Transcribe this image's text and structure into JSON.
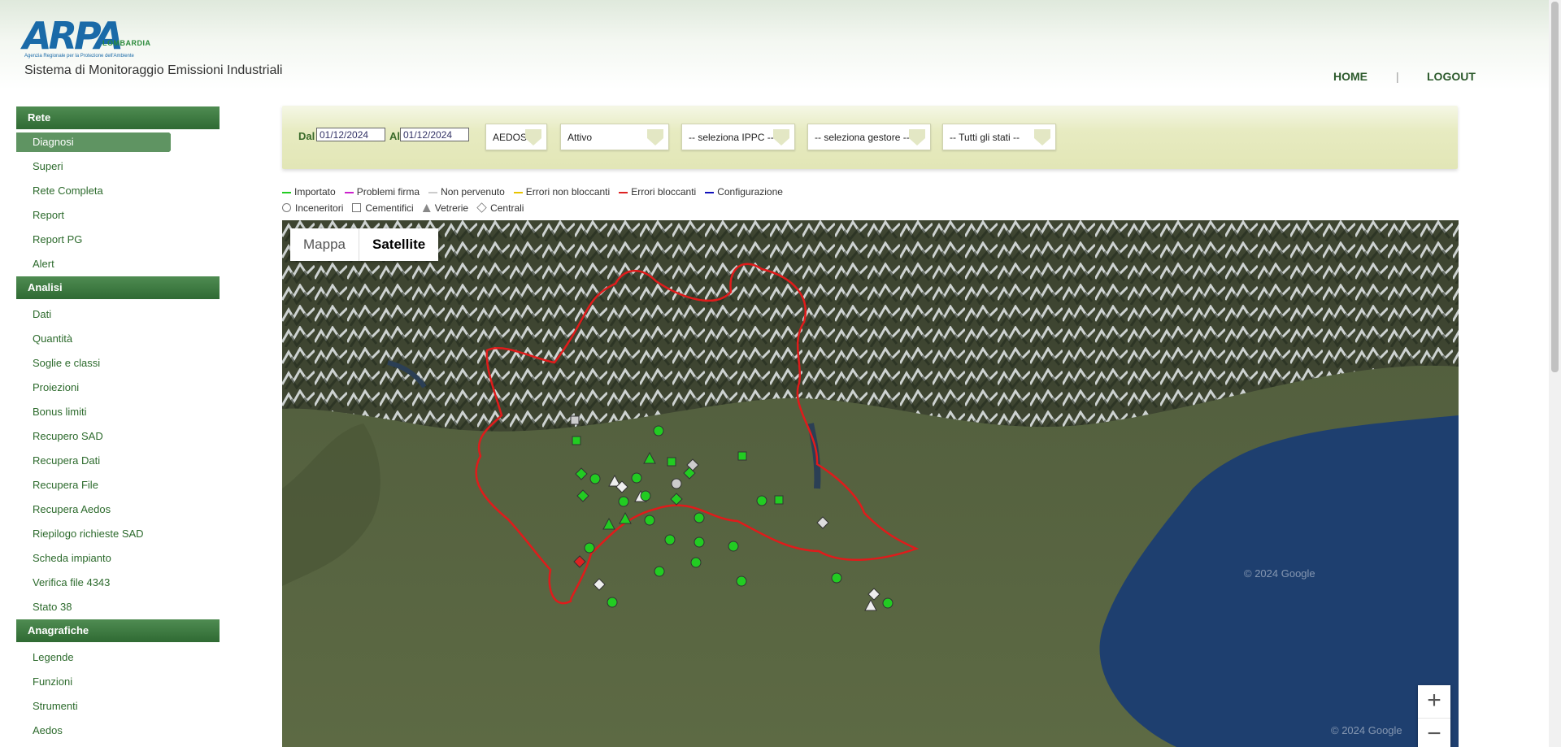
{
  "header": {
    "logo_text": "ARPA",
    "logo_region": "LOMBARDIA",
    "logo_tagline": "Agenzia Regionale per la Protezione dell'Ambiente",
    "app_title": "Sistema di Monitoraggio Emissioni Industriali",
    "nav_home": "HOME",
    "nav_separator": "|",
    "nav_logout": "LOGOUT"
  },
  "sidebar": {
    "sections": [
      {
        "title": "Rete",
        "items": [
          "Diagnosi",
          "Superi",
          "Rete Completa",
          "Report",
          "Report PG",
          "Alert"
        ],
        "active": "Diagnosi"
      },
      {
        "title": "Analisi",
        "items": [
          "Dati",
          "Quantità",
          "Soglie e classi",
          "Proiezioni",
          "Bonus limiti",
          "Recupero SAD",
          "Recupera Dati",
          "Recupera File",
          "Recupera Aedos",
          "Riepilogo richieste SAD",
          "Scheda impianto",
          "Verifica file 4343",
          "Stato 38"
        ]
      },
      {
        "title": "Anagrafiche",
        "items": [
          "Legende",
          "Funzioni",
          "Strumenti",
          "Aedos"
        ]
      }
    ]
  },
  "filters": {
    "from_label": "Dal",
    "from_value": "01/12/2024",
    "to_label": "Al",
    "to_value": "01/12/2024",
    "source": "AEDOS",
    "status": "Attivo",
    "ippc": "-- seleziona IPPC --",
    "gestore": "-- seleziona gestore --",
    "stati": "-- Tutti gli stati --"
  },
  "legend": {
    "states": [
      {
        "label": "Importato",
        "color": "#22cc22"
      },
      {
        "label": "Problemi firma",
        "color": "#cc22cc"
      },
      {
        "label": "Non pervenuto",
        "color": "#cccccc"
      },
      {
        "label": "Errori non bloccanti",
        "color": "#e8c400"
      },
      {
        "label": "Errori bloccanti",
        "color": "#dd2222"
      },
      {
        "label": "Configurazione",
        "color": "#1111bb"
      }
    ],
    "types": [
      {
        "label": "Inceneritori",
        "icon": "circle-icon"
      },
      {
        "label": "Cementifici",
        "icon": "square-icon"
      },
      {
        "label": "Vetrerie",
        "icon": "triangle-icon"
      },
      {
        "label": "Centrali",
        "icon": "diamond-icon"
      }
    ]
  },
  "map": {
    "type_map": "Mappa",
    "type_satellite": "Satellite",
    "selected_type": "Satellite",
    "zoom_in": "+",
    "zoom_out": "−",
    "watermark_1": "© 2024 Google",
    "watermark_2": "© 2024 Google"
  }
}
